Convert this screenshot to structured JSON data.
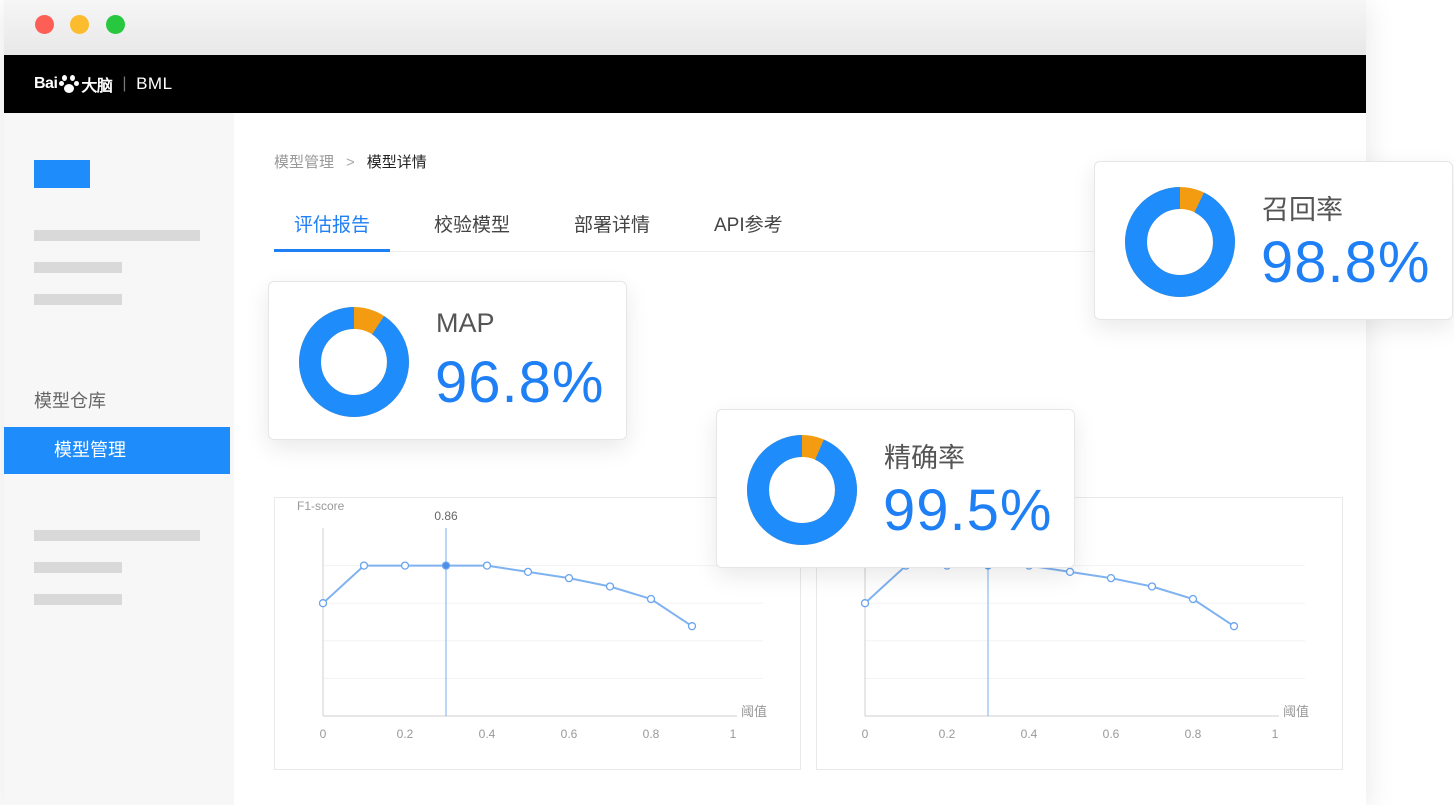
{
  "topnav": {
    "brand_prefix": "Bai",
    "brand_cn": "大脑",
    "product": "BML"
  },
  "sidebar": {
    "section_title": "模型仓库",
    "active_item": "模型管理"
  },
  "breadcrumb": {
    "parent": "模型管理",
    "current": "模型详情"
  },
  "tabs": [
    "评估报告",
    "校验模型",
    "部署详情",
    "API参考"
  ],
  "metrics": [
    {
      "label": "MAP",
      "value": "96.8%",
      "fraction": 0.968
    },
    {
      "label": "精确率",
      "value": "99.5%",
      "fraction": 0.995
    },
    {
      "label": "召回率",
      "value": "98.8%",
      "fraction": 0.988
    }
  ],
  "colors": {
    "accent": "#1f8cfc",
    "segment": "#f39c12"
  },
  "chart_data": [
    {
      "type": "line",
      "ylabel": "F1-score",
      "xlabel": "阈值",
      "xticks": [
        "0",
        "0.2",
        "0.4",
        "0.6",
        "0.8",
        "1"
      ],
      "xlim": [
        0,
        1
      ],
      "ylim": [
        0.5,
        0.95
      ],
      "highlight": {
        "x": 0.3,
        "label": "0.86"
      },
      "x": [
        0,
        0.1,
        0.2,
        0.3,
        0.4,
        0.5,
        0.6,
        0.7,
        0.8,
        0.9
      ],
      "y": [
        0.77,
        0.86,
        0.86,
        0.86,
        0.86,
        0.845,
        0.83,
        0.81,
        0.78,
        0.715
      ]
    },
    {
      "type": "line",
      "ylabel": "",
      "xlabel": "阈值",
      "xticks": [
        "0",
        "0.2",
        "0.4",
        "0.6",
        "0.8",
        "1"
      ],
      "xlim": [
        0,
        1
      ],
      "ylim": [
        0.5,
        0.95
      ],
      "highlight": {
        "x": 0.3,
        "label": ""
      },
      "x": [
        0,
        0.1,
        0.2,
        0.3,
        0.4,
        0.5,
        0.6,
        0.7,
        0.8,
        0.9
      ],
      "y": [
        0.77,
        0.86,
        0.86,
        0.86,
        0.86,
        0.845,
        0.83,
        0.81,
        0.78,
        0.715
      ]
    }
  ]
}
